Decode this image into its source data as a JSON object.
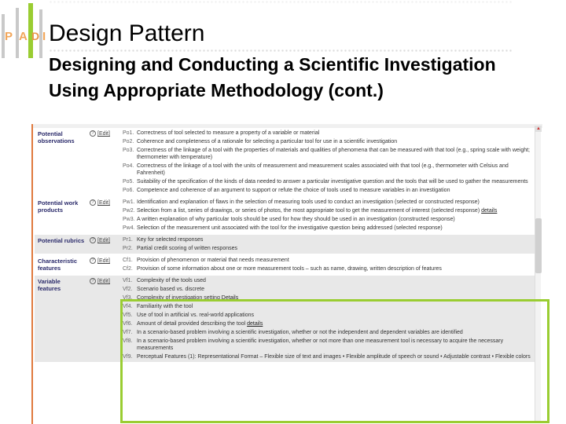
{
  "logo": {
    "letters": [
      "P",
      "A",
      "D",
      "I"
    ]
  },
  "slide": {
    "title": "Design Pattern",
    "subtitle": "Designing and Conducting a Scientific Investigation Using Appropriate Methodology (cont.)"
  },
  "colors": {
    "accent_border": "#e07a3e",
    "highlight": "#9acd32",
    "logo_orange": "#f2a65a"
  },
  "edit_label": "[Edit]",
  "help_icon": "question-circle-icon",
  "sections": [
    {
      "label": "Potential observations",
      "shaded": false,
      "items": [
        {
          "code": "Po1.",
          "text": "Correctness of tool selected to measure a property of a variable or material"
        },
        {
          "code": "Po2.",
          "text": "Coherence and completeness of a rationale for selecting a particular tool for use in a scientific investigation"
        },
        {
          "code": "Po3.",
          "text": "Correctness of the linkage of a tool with the properties of materials and qualities of phenomena that can be measured with that tool (e.g., spring scale with weight; thermometer with temperature)"
        },
        {
          "code": "Po4.",
          "text": "Correctness of the linkage of a tool with the units of measurement and measurement scales associated with that tool (e.g., thermometer with Celsius and Fahrenheit)"
        },
        {
          "code": "Po5.",
          "text": "Suitability of the specification of the kinds of data needed to answer a particular investigative question and the tools that will be used to gather the measurements"
        },
        {
          "code": "Po6.",
          "text": "Competence and coherence of an argument to support or refute the choice of tools used to measure variables in an investigation"
        }
      ]
    },
    {
      "label": "Potential work products",
      "shaded": false,
      "items": [
        {
          "code": "Pw1.",
          "text": "Identification and explanation of flaws in the selection of measuring tools used to conduct an investigation (selected or constructed response)"
        },
        {
          "code": "Pw2.",
          "text": "Selection from a list, series of drawings, or series of photos, the most appropriate tool to get the measurement of interest (selected response)",
          "link": "details"
        },
        {
          "code": "Pw3.",
          "text": "A written explanation of why particular tools should be used for how they should be used in an investigation (constructed response)"
        },
        {
          "code": "Pw4.",
          "text": "Selection of the measurement unit associated with the tool for the investigative question being addressed (selected response)"
        }
      ]
    },
    {
      "label": "Potential rubrics",
      "shaded": true,
      "items": [
        {
          "code": "Pr1.",
          "text": "Key for selected responses"
        },
        {
          "code": "Pr2.",
          "text": "Partial credit scoring of written responses"
        }
      ]
    },
    {
      "label": "Characteristic features",
      "shaded": false,
      "items": [
        {
          "code": "Cf1.",
          "text": "Provision of phenomenon or material that needs measurement"
        },
        {
          "code": "Cf2.",
          "text": "Provision of some information about one or more measurement tools – such as name, drawing, written description of features"
        }
      ]
    },
    {
      "label": "Variable features",
      "shaded": true,
      "items": [
        {
          "code": "Vf1.",
          "text": "Complexity of the tools used"
        },
        {
          "code": "Vf2.",
          "text": "Scenario based vs. discrete"
        },
        {
          "code": "Vf3.",
          "text": "Complexity of investigation setting",
          "link": "Details"
        },
        {
          "code": "Vf4.",
          "text": "Familiarity with the tool"
        },
        {
          "code": "Vf5.",
          "text": "Use of tool in artificial vs. real-world applications"
        },
        {
          "code": "Vf6.",
          "text": "Amount of detail provided describing the tool",
          "link": "details"
        },
        {
          "code": "Vf7.",
          "text": "In a scenario-based problem involving a scientific investigation, whether or not the independent and dependent variables are identified"
        },
        {
          "code": "Vf8.",
          "text": "In a scenario-based problem involving a scientific investigation, whether or not more than one measurement tool is necessary to acquire the necessary measurements"
        },
        {
          "code": "Vf9.",
          "text": "Perceptual Features (1): Representational Format – Flexible size of text and images • Flexible amplitude of speech or sound • Adjustable contrast • Flexible colors"
        }
      ]
    }
  ]
}
